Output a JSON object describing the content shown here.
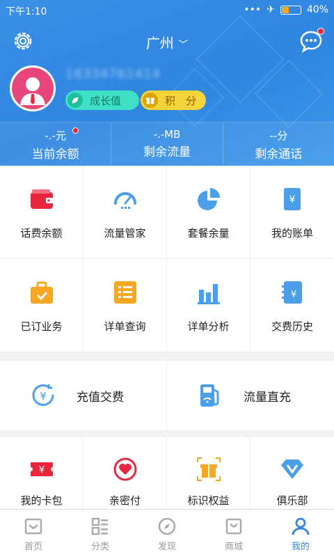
{
  "status": {
    "time": "下午1:10",
    "battery": "40%",
    "battery_level": 0.4
  },
  "header": {
    "city": "广州",
    "phone": "18334761414"
  },
  "badges": {
    "growth": "成长值",
    "points": "积　分"
  },
  "stats": [
    {
      "value": "-.-元",
      "label": "当前余额"
    },
    {
      "value": "-.-MB",
      "label": "剩余流量"
    },
    {
      "value": "--分",
      "label": "剩余通话"
    }
  ],
  "grid": [
    {
      "label": "话费余额",
      "icon": "wallet-icon"
    },
    {
      "label": "流量管家",
      "icon": "gauge-icon"
    },
    {
      "label": "套餐余量",
      "icon": "pie-icon"
    },
    {
      "label": "我的账单",
      "icon": "bill-icon"
    },
    {
      "label": "已订业务",
      "icon": "briefcase-icon"
    },
    {
      "label": "详单查询",
      "icon": "list-icon"
    },
    {
      "label": "详单分析",
      "icon": "bar-chart-icon"
    },
    {
      "label": "交费历史",
      "icon": "notebook-icon"
    }
  ],
  "quick": [
    {
      "label": "充值交费",
      "icon": "yuan-circle-icon"
    },
    {
      "label": "流量直充",
      "icon": "fuel-pump-icon"
    }
  ],
  "grid3": [
    {
      "label": "我的卡包",
      "icon": "ticket-icon"
    },
    {
      "label": "亲密付",
      "icon": "heart-circle-icon"
    },
    {
      "label": "标识权益",
      "icon": "gift-icon"
    },
    {
      "label": "俱乐部",
      "icon": "diamond-icon"
    }
  ],
  "tabs": [
    {
      "label": "首页",
      "icon": "home-icon"
    },
    {
      "label": "分类",
      "icon": "category-icon"
    },
    {
      "label": "发现",
      "icon": "compass-icon"
    },
    {
      "label": "商城",
      "icon": "shop-icon"
    },
    {
      "label": "我的",
      "icon": "user-icon",
      "active": true
    }
  ],
  "colors": {
    "primary": "#2f86e0",
    "red": "#e8263e",
    "orange": "#f5a623",
    "blue": "#4a9eea"
  }
}
